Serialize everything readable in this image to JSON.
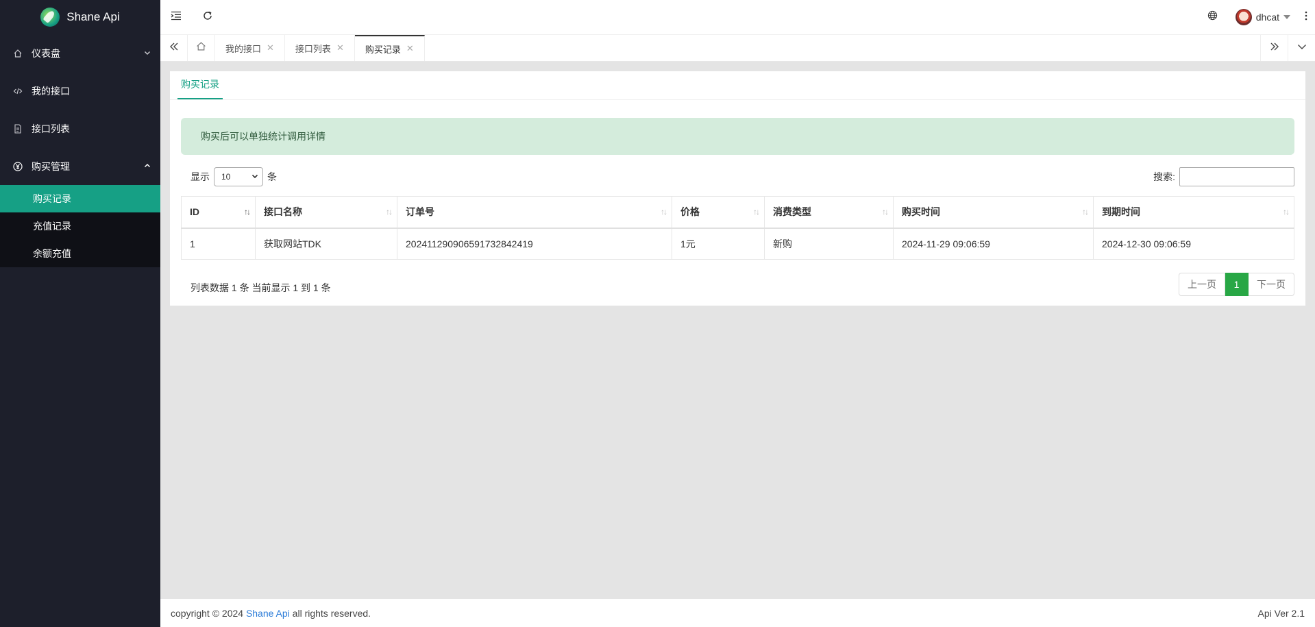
{
  "app": {
    "name": "Shane Api"
  },
  "sidebar": {
    "items": [
      {
        "icon": "home-icon",
        "label": "仪表盘",
        "expanded": false
      },
      {
        "icon": "code-icon",
        "label": "我的接口"
      },
      {
        "icon": "document-icon",
        "label": "接口列表"
      },
      {
        "icon": "yen-icon",
        "label": "购买管理",
        "expanded": true,
        "children": [
          "购买记录",
          "充值记录",
          "余额充值"
        ]
      }
    ]
  },
  "header": {
    "username": "dhcat"
  },
  "tabs": [
    {
      "label": "我的接口"
    },
    {
      "label": "接口列表"
    },
    {
      "label": "购买记录",
      "active": true
    }
  ],
  "page": {
    "card_tab": "购买记录",
    "alert": "购买后可以单独统计调用详情",
    "show_label": "显示",
    "page_size": "10",
    "unit_label": "条",
    "search_label": "搜索:",
    "search_value": "",
    "table": {
      "columns": [
        "ID",
        "接口名称",
        "订单号",
        "价格",
        "消费类型",
        "购买时间",
        "到期时间"
      ],
      "rows": [
        [
          "1",
          "获取网站TDK",
          "20241129090659173284241​9",
          "1元",
          "新购",
          "2024-11-29 09:06:59",
          "2024-12-30 09:06:59"
        ]
      ]
    },
    "info": "列表数据 1 条 当前显示 1 到 1 条",
    "pager": {
      "prev": "上一页",
      "current": "1",
      "next": "下一页"
    }
  },
  "footer": {
    "prefix": "copyright © 2024 ",
    "brand": "Shane Api",
    "suffix": " all rights reserved.",
    "version": "Api Ver 2.1"
  },
  "colors": {
    "accent": "#16a085",
    "sidebar_bg": "#1d1f2b",
    "alert_bg": "#d4ecdc",
    "pager_active": "#28a745"
  }
}
